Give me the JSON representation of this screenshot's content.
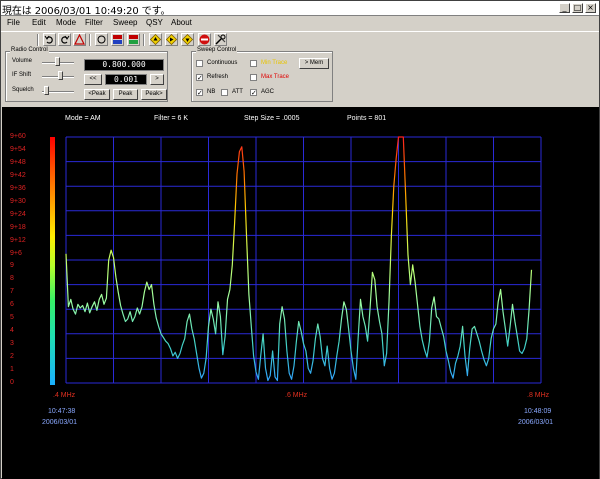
{
  "window": {
    "title": "現在は 2006/03/01 10:49:20 です。"
  },
  "menu": {
    "items": [
      "File",
      "Edit",
      "Mode",
      "Filter",
      "Sweep",
      "QSY",
      "About"
    ]
  },
  "toolbar": {
    "buttons": [
      {
        "icon": "undo-icon"
      },
      {
        "icon": "redo-icon"
      },
      {
        "icon": "warning-icon"
      },
      {
        "icon": "refresh-icon"
      },
      {
        "icon": "recorder-icon"
      },
      {
        "icon": "recorder-icon"
      },
      {
        "icon": "up-diamond-icon"
      },
      {
        "icon": "right-diamond-icon"
      },
      {
        "icon": "down-diamond-icon"
      },
      {
        "icon": "stop-icon"
      },
      {
        "icon": "tools-icon"
      }
    ]
  },
  "radio_control": {
    "group_title": "Radio Control",
    "volume_label": "Volume",
    "if_shift_label": "IF Shift",
    "squelch_label": "Squelch",
    "frequency": "0.800.000",
    "step_button": "<<",
    "step_value": "0.001",
    "step_next": ">",
    "peak_prev": "<Peak",
    "peak": "Peak",
    "peak_next": "Peak>"
  },
  "sweep_control": {
    "group_title": "Sweep Control",
    "continuous_label": "Continuous",
    "refresh_label": "Refresh",
    "min_trace_label": "Min Trace",
    "max_trace_label": "Max Trace",
    "mem_button": "> Mem",
    "nb_label": "NB",
    "att_label": "ATT",
    "agc_label": "AGC",
    "continuous_checked": false,
    "refresh_checked": true,
    "min_trace_checked": false,
    "max_trace_checked": false,
    "nb_checked": true,
    "att_checked": false,
    "agc_checked": true,
    "min_trace_color": "#e8c400",
    "max_trace_color": "#e00000"
  },
  "display": {
    "mode": "Mode = AM",
    "filter": "Filter = 6 K",
    "step_size": "Step Size = .0005",
    "points": "Points = 801",
    "y_labels": [
      "9+60",
      "9+54",
      "9+48",
      "9+42",
      "9+36",
      "9+30",
      "9+24",
      "9+18",
      "9+12",
      "9+6",
      "9",
      "8",
      "7",
      "6",
      "5",
      "4",
      "3",
      "2",
      "1",
      "0"
    ],
    "x_start": ".4 MHz",
    "x_mid": ".6 MHz",
    "x_end": ".8 MHz",
    "start_time": "10:47:38",
    "start_date": "2006/03/01",
    "end_time": "10:48:09",
    "end_date": "2006/03/01"
  },
  "chart_data": {
    "type": "line",
    "xlabel": "",
    "ylabel": "",
    "x_range_mhz": [
      0.4,
      0.8
    ],
    "y_range_units": [
      0,
      20
    ],
    "grid": true,
    "trace_color_gradient": true,
    "series": [
      {
        "x_mhz": [
          0.4,
          0.402,
          0.404,
          0.406,
          0.408,
          0.41,
          0.412,
          0.414,
          0.416,
          0.418,
          0.42,
          0.422,
          0.424,
          0.426,
          0.428,
          0.43,
          0.432,
          0.434,
          0.436,
          0.438,
          0.44,
          0.442,
          0.444,
          0.446,
          0.448,
          0.45,
          0.452,
          0.454,
          0.456,
          0.458,
          0.46,
          0.462,
          0.464,
          0.466,
          0.468,
          0.47,
          0.472,
          0.474,
          0.476,
          0.478,
          0.48,
          0.482,
          0.484,
          0.486,
          0.488,
          0.49,
          0.492,
          0.494,
          0.496,
          0.498,
          0.5,
          0.502,
          0.504,
          0.506,
          0.508,
          0.51,
          0.512,
          0.514,
          0.516,
          0.518,
          0.52,
          0.522,
          0.524,
          0.526,
          0.528,
          0.53,
          0.532,
          0.534,
          0.536,
          0.538,
          0.54,
          0.542,
          0.544,
          0.546,
          0.548,
          0.55,
          0.552,
          0.554,
          0.556,
          0.558,
          0.56,
          0.562,
          0.564,
          0.566,
          0.568,
          0.57,
          0.572,
          0.574,
          0.576,
          0.578,
          0.58,
          0.582,
          0.584,
          0.586,
          0.588,
          0.59,
          0.592,
          0.594,
          0.596,
          0.598,
          0.6,
          0.602,
          0.604,
          0.606,
          0.608,
          0.61,
          0.612,
          0.614,
          0.616,
          0.618,
          0.62,
          0.622,
          0.624,
          0.626,
          0.628,
          0.63,
          0.632,
          0.634,
          0.636,
          0.638,
          0.64,
          0.642,
          0.644,
          0.646,
          0.648,
          0.65,
          0.652,
          0.654,
          0.656,
          0.658,
          0.66,
          0.662,
          0.664,
          0.666,
          0.668,
          0.67,
          0.672,
          0.674,
          0.676,
          0.678,
          0.68,
          0.682,
          0.684,
          0.686,
          0.688,
          0.69,
          0.692,
          0.694,
          0.696,
          0.698,
          0.7,
          0.702,
          0.704,
          0.706,
          0.708,
          0.71,
          0.712,
          0.714,
          0.716,
          0.718,
          0.72,
          0.722,
          0.724,
          0.726,
          0.728,
          0.73,
          0.732,
          0.734,
          0.736,
          0.738,
          0.74,
          0.742,
          0.744,
          0.746,
          0.748,
          0.75,
          0.752,
          0.754,
          0.756,
          0.758,
          0.76,
          0.762,
          0.764,
          0.766,
          0.768,
          0.77,
          0.772,
          0.774,
          0.776,
          0.778,
          0.78,
          0.782,
          0.784,
          0.786,
          0.788,
          0.79,
          0.792,
          0.794,
          0.796,
          0.798,
          0.8
        ],
        "y": [
          10.5,
          6.2,
          6.8,
          6.0,
          5.6,
          6.4,
          6.1,
          6.3,
          5.8,
          6.5,
          5.7,
          6.2,
          6.6,
          5.9,
          6.8,
          7.2,
          6.4,
          6.9,
          10.0,
          10.8,
          10.2,
          8.6,
          7.4,
          6.3,
          5.6,
          5.0,
          5.2,
          5.8,
          5.0,
          5.4,
          6.1,
          5.6,
          6.2,
          7.4,
          8.2,
          7.6,
          8.0,
          6.4,
          5.3,
          4.6,
          4.0,
          3.7,
          3.4,
          3.2,
          2.8,
          2.2,
          2.5,
          2.0,
          2.4,
          3.1,
          3.6,
          5.0,
          5.6,
          4.4,
          3.6,
          2.4,
          1.2,
          0.4,
          0.8,
          2.0,
          4.6,
          6.0,
          5.2,
          4.0,
          6.6,
          5.4,
          2.3,
          3.8,
          6.8,
          7.6,
          9.6,
          13.0,
          17.0,
          18.8,
          19.2,
          17.2,
          12.0,
          7.2,
          4.6,
          2.2,
          0.9,
          0.3,
          2.2,
          4.0,
          1.2,
          0.2,
          0.6,
          2.6,
          0.5,
          0.2,
          4.8,
          6.2,
          5.2,
          2.6,
          0.8,
          0.3,
          1.4,
          3.4,
          5.0,
          4.2,
          3.2,
          2.6,
          1.2,
          0.8,
          1.8,
          3.6,
          4.8,
          3.8,
          2.0,
          1.4,
          3.0,
          1.2,
          0.3,
          0.8,
          2.2,
          3.4,
          5.2,
          6.6,
          6.0,
          4.4,
          2.6,
          1.2,
          0.3,
          3.6,
          6.8,
          5.4,
          4.6,
          3.4,
          6.0,
          9.0,
          8.4,
          6.2,
          5.0,
          4.0,
          1.4,
          2.4,
          6.6,
          12.0,
          16.0,
          18.2,
          20.0,
          20.0,
          20.0,
          15.4,
          10.4,
          8.0,
          9.6,
          8.2,
          6.4,
          4.6,
          3.5,
          2.7,
          2.1,
          3.4,
          6.1,
          7.0,
          5.4,
          5.2,
          4.5,
          3.8,
          2.6,
          1.8,
          0.9,
          0.4,
          1.6,
          2.2,
          3.0,
          4.6,
          2.2,
          0.6,
          2.8,
          4.4,
          4.6,
          4.0,
          3.4,
          2.6,
          1.9,
          1.4,
          2.0,
          3.6,
          4.4,
          4.8,
          6.6,
          7.6,
          5.8,
          4.4,
          3.0,
          4.6,
          6.4,
          5.0,
          3.8,
          2.6,
          2.4,
          2.8,
          3.6,
          6.0,
          9.2
        ]
      }
    ]
  }
}
